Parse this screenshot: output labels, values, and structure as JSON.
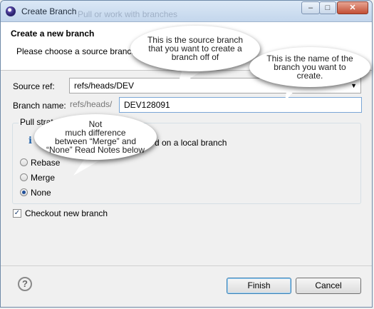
{
  "window": {
    "title": "Create Branch",
    "title_behind": "Pull or work with branches",
    "controls": {
      "minimize": "–",
      "maximize": "□",
      "close": "✕"
    }
  },
  "header": {
    "title": "Create a new branch",
    "description": "Please choose a source branch and"
  },
  "form": {
    "source_ref_label": "Source ref:",
    "source_ref_value": "refs/heads/DEV",
    "branch_name_label": "Branch name:",
    "branch_prefix": "refs/heads/",
    "branch_name_value": "DEV128091"
  },
  "pull_strategy": {
    "group_label": "Pull strategy",
    "info_text": "d on a local branch",
    "options": [
      {
        "label": "Rebase",
        "selected": false
      },
      {
        "label": "Merge",
        "selected": false
      },
      {
        "label": "None",
        "selected": true
      }
    ]
  },
  "checkout": {
    "label": "Checkout new branch",
    "checked": true
  },
  "buttons": {
    "finish": "Finish",
    "cancel": "Cancel",
    "help": "?"
  },
  "callouts": {
    "source": "This is the source branch\nthat you want to create a\nbranch off of",
    "name": "This is the name of the\nbranch you want to\ncreate.",
    "strategy": "Not\nmuch difference\nbetween “Merge” and\n“None” Read Notes below"
  },
  "icons": {
    "app": "eclipse-icon",
    "info": "info-icon",
    "help": "help-icon",
    "dropdown": "chevron-down-icon"
  }
}
